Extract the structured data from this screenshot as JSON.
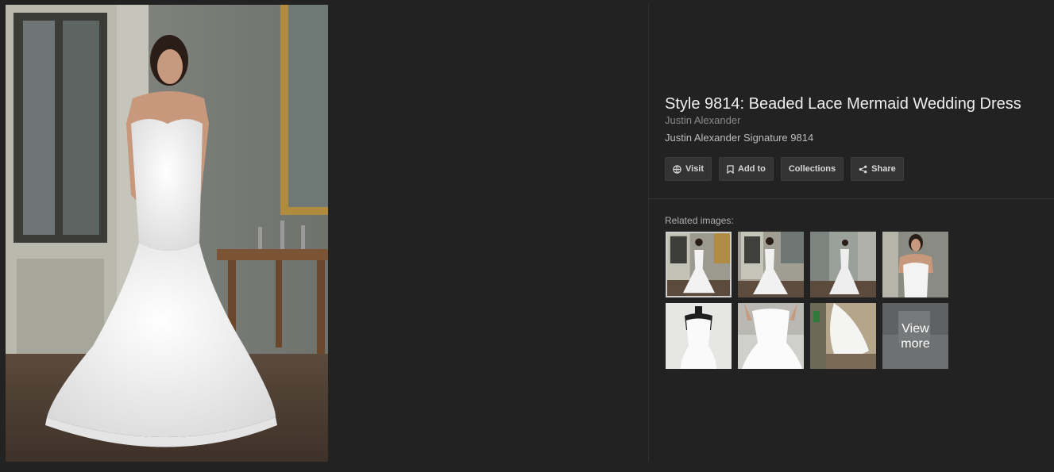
{
  "main_image": {
    "alt_name": "wedding-dress-photo"
  },
  "info": {
    "title": "Style 9814: Beaded Lace Mermaid Wedding Dress",
    "source": "Justin Alexander",
    "description": "Justin Alexander Signature 9814"
  },
  "actions": {
    "visit_label": "Visit",
    "add_label": "Add to",
    "collections_label": "Collections",
    "share_label": "Share",
    "visit_icon": "globe-icon",
    "add_icon": "bookmark-icon",
    "share_icon": "share-icon"
  },
  "related": {
    "label": "Related images:",
    "thumbnails": [
      {
        "desc": "bride front full",
        "selected": true
      },
      {
        "desc": "bride back view"
      },
      {
        "desc": "bride back full room"
      },
      {
        "desc": "bride portrait"
      },
      {
        "desc": "dress on mannequin"
      },
      {
        "desc": "bodice closeup"
      },
      {
        "desc": "skirt detail"
      }
    ],
    "view_more_label": "View more"
  },
  "colors": {
    "background": "#222222",
    "button_bg": "#333333",
    "title": "#eeeeee"
  }
}
